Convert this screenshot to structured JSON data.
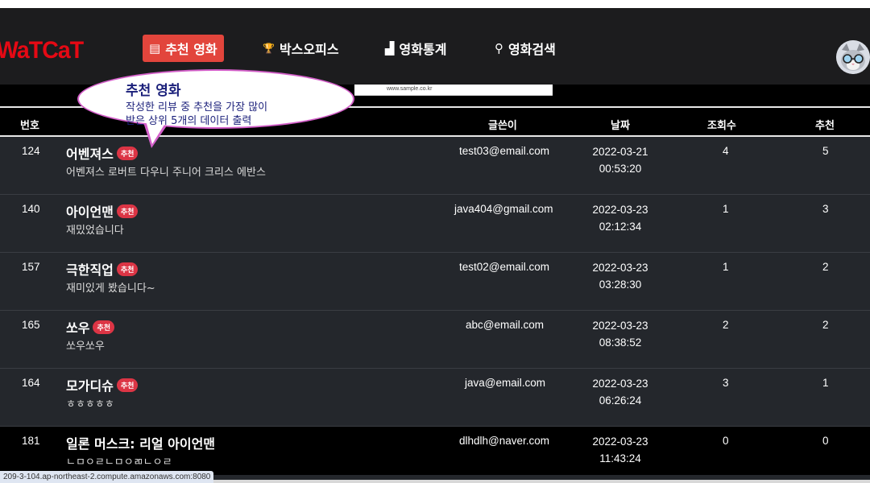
{
  "app": {
    "logo": "WaTCaT"
  },
  "nav": {
    "items": [
      {
        "label": "추천 영화",
        "icon": "list-icon",
        "glyph": "▤"
      },
      {
        "label": "박스오피스",
        "icon": "trophy-icon",
        "glyph": "🏆"
      },
      {
        "label": "영화통계",
        "icon": "bar-chart-icon",
        "glyph": "▟"
      },
      {
        "label": "영화검색",
        "icon": "search-icon",
        "glyph": "⚲"
      }
    ]
  },
  "banner": {
    "text": "www.sample.co.kr"
  },
  "table": {
    "headers": {
      "num": "번호",
      "writer": "글쓴이",
      "date": "날짜",
      "views": "조회수",
      "recommend": "추천"
    },
    "rows": [
      {
        "num": "124",
        "title": "어벤져스",
        "badge": "추천",
        "content": "어벤져스 로버트 다우니 주니어 크리스 에반스",
        "writer": "test03@email.com",
        "date": "2022-03-21",
        "time": "00:53:20",
        "views": "4",
        "recommend": "5"
      },
      {
        "num": "140",
        "title": "아이언맨",
        "badge": "추천",
        "content": "재밌었습니다",
        "writer": "java404@gmail.com",
        "date": "2022-03-23",
        "time": "02:12:34",
        "views": "1",
        "recommend": "3"
      },
      {
        "num": "157",
        "title": "극한직업",
        "badge": "추천",
        "content": "재미있게 봤습니다~",
        "writer": "test02@email.com",
        "date": "2022-03-23",
        "time": "03:28:30",
        "views": "1",
        "recommend": "2"
      },
      {
        "num": "165",
        "title": "쏘우",
        "badge": "추천",
        "content": "쏘우쏘우",
        "writer": "abc@email.com",
        "date": "2022-03-23",
        "time": "08:38:52",
        "views": "2",
        "recommend": "2"
      },
      {
        "num": "164",
        "title": "모가디슈",
        "badge": "추천",
        "content": "ㅎㅎㅎㅎㅎ",
        "writer": "java@email.com",
        "date": "2022-03-23",
        "time": "06:26:24",
        "views": "3",
        "recommend": "1"
      },
      {
        "num": "181",
        "title": "일론 머스크: 리얼 아이언맨",
        "badge": "",
        "content": "ㄴㅁㅇㄹㄴㅁㅇㄻㄴㅇㄹ",
        "writer": "dlhdlh@naver.com",
        "date": "2022-03-23",
        "time": "11:43:24",
        "views": "0",
        "recommend": "0"
      }
    ]
  },
  "callout": {
    "title": "추천 영화",
    "line1": "작성한 리뷰 중 추천을 가장 많이",
    "line2": "받은 상위 5개의 데이터 출력"
  },
  "status_bar": {
    "url": "209-3-104.ap-northeast-2.compute.amazonaws.com:8080"
  },
  "colors": {
    "brand": "#e50914",
    "active_nav": "#e2453c",
    "badge": "#dc3545",
    "callout_border": "#d35fc9"
  }
}
